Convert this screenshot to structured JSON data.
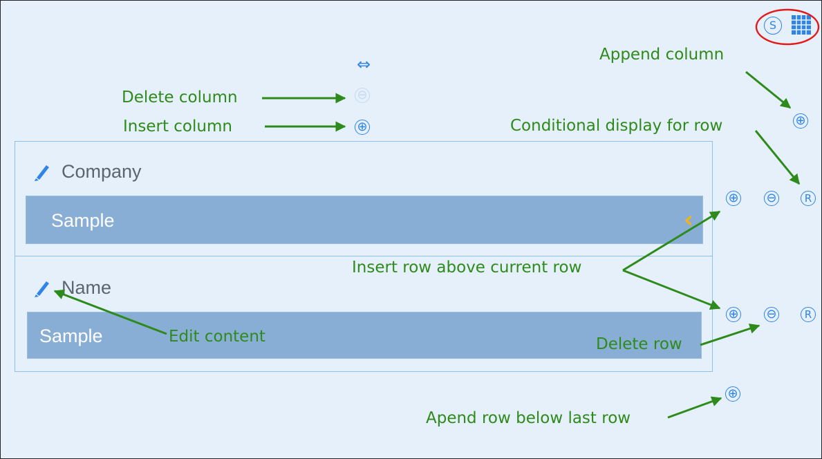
{
  "toolbar": {
    "icons": [
      "s-circle-icon",
      "table-grid-icon"
    ],
    "highlight_color": "#e21a1a"
  },
  "column_controls": {
    "resize_icon_glyph": "⇔",
    "delete_column_glyph": "⊖",
    "insert_column_glyph": "⊕",
    "append_column_glyph": "⊕",
    "s_glyph": "S"
  },
  "table": {
    "rows": [
      {
        "label": "Company",
        "value": "Sample"
      },
      {
        "label": "Name",
        "value": "Sample"
      }
    ],
    "chevron_glyph": "‹"
  },
  "row_controls": {
    "insert_glyph": "⊕",
    "delete_glyph": "⊖",
    "conditional_glyph": "R",
    "append_glyph": "⊕"
  },
  "annotations": {
    "append_column": "Append column",
    "delete_column": "Delete column",
    "insert_column": "Insert column",
    "conditional_display": "Conditional display for row",
    "insert_row_above": "Insert row above current row",
    "edit_content": "Edit content",
    "delete_row": "Delete row",
    "append_row": "Apend row below last row"
  },
  "colors": {
    "background": "#e5f0fb",
    "annotation_green": "#2e8a1a",
    "icon_blue": "#2f84e6",
    "sample_bar": "#89aed6",
    "chevron": "#f2b21a"
  }
}
